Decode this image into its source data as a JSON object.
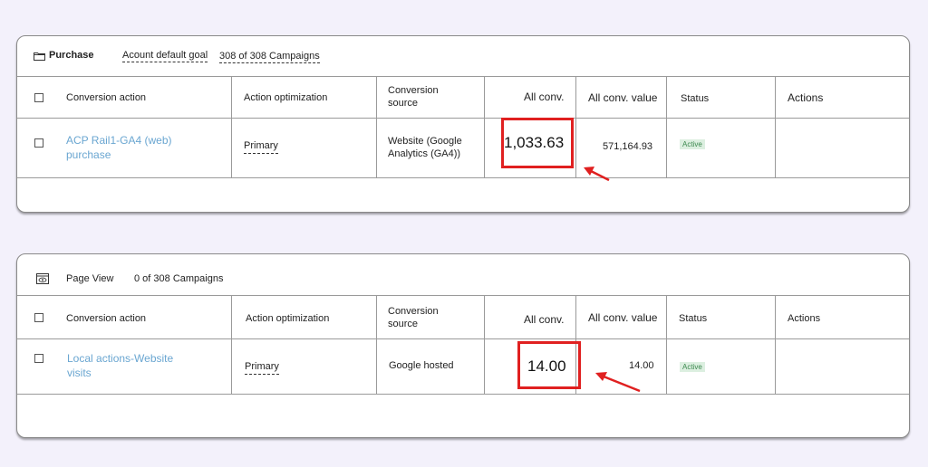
{
  "accent": "#e02020",
  "link_color": "#6aa6d1",
  "status_color": "#3d8a50",
  "sections": [
    {
      "icon": "folder-icon",
      "title": "Purchase",
      "goal_label": "Acount default goal",
      "campaigns": "308 of 308 Campaigns",
      "headers": {
        "conversion_action": "Conversion action",
        "action_optimization": "Action optimization",
        "conversion_source": "Conversion source",
        "all_conv": "All conv.",
        "all_conv_value": "All conv. value",
        "status": "Status",
        "actions": "Actions"
      },
      "row": {
        "conversion_action": "ACP Rail1-GA4 (web) purchase",
        "action_optimization": "Primary",
        "conversion_source": "Website (Google Analytics (GA4))",
        "all_conv": "1,033.63",
        "all_conv_value": "571,164.93",
        "status": "Active"
      }
    },
    {
      "icon": "eye-window-icon",
      "title": "Page View",
      "campaigns": "0 of 308 Campaigns",
      "headers": {
        "conversion_action": "Conversion action",
        "action_optimization": "Action optimization",
        "conversion_source": "Conversion source",
        "all_conv": "All conv.",
        "all_conv_value": "All conv. value",
        "status": "Status",
        "actions": "Actions"
      },
      "row": {
        "conversion_action": "Local actions-Website visits",
        "action_optimization": "Primary",
        "conversion_source": "Google hosted",
        "all_conv": "14.00",
        "all_conv_value": "14.00",
        "status": "Active"
      }
    }
  ]
}
